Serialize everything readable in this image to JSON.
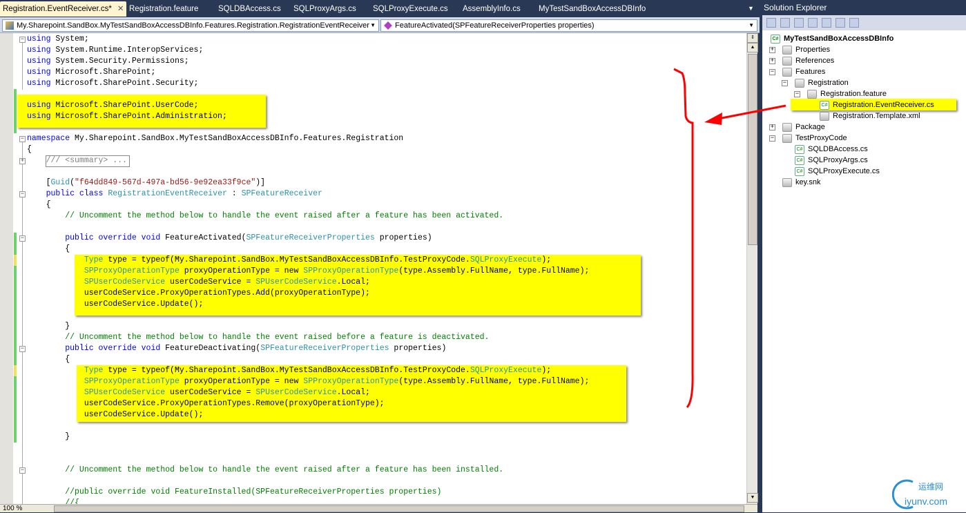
{
  "tabs": [
    {
      "label": "Registration.EventReceiver.cs*",
      "active": true
    },
    {
      "label": "Registration.feature"
    },
    {
      "label": "SQLDBAccess.cs"
    },
    {
      "label": "SQLProxyArgs.cs"
    },
    {
      "label": "SQLProxyExecute.cs"
    },
    {
      "label": "AssemblyInfo.cs"
    },
    {
      "label": "MyTestSandBoxAccessDBInfo"
    }
  ],
  "nav": {
    "type_selector": "My.Sharepoint.SandBox.MyTestSandBoxAccessDBInfo.Features.Registration.RegistrationEventReceiver",
    "member_selector": "FeatureActivated(SPFeatureReceiverProperties properties)"
  },
  "code": [
    [
      [
        "k",
        "using"
      ],
      [
        "p",
        " System;"
      ]
    ],
    [
      [
        "k",
        "using"
      ],
      [
        "p",
        " System.Runtime.InteropServices;"
      ]
    ],
    [
      [
        "k",
        "using"
      ],
      [
        "p",
        " System.Security.Permissions;"
      ]
    ],
    [
      [
        "k",
        "using"
      ],
      [
        "p",
        " Microsoft.SharePoint;"
      ]
    ],
    [
      [
        "k",
        "using"
      ],
      [
        "p",
        " Microsoft.SharePoint.Security;"
      ]
    ],
    [],
    [
      [
        "k",
        "using"
      ],
      [
        "p",
        " Microsoft.SharePoint.UserCode;"
      ]
    ],
    [
      [
        "k",
        "using"
      ],
      [
        "p",
        " Microsoft.SharePoint.Administration;"
      ]
    ],
    [],
    [
      [
        "k",
        "namespace"
      ],
      [
        "p",
        " My.Sharepoint.SandBox.MyTestSandBoxAccessDBInfo.Features.Registration"
      ]
    ],
    [
      [
        "p",
        "{"
      ]
    ],
    [
      [
        "p",
        "    "
      ],
      [
        "g",
        "/// <summary> ..."
      ]
    ],
    [],
    [
      [
        "p",
        "    ["
      ],
      [
        "t",
        "Guid"
      ],
      [
        "p",
        "("
      ],
      [
        "s",
        "\"f64dd849-567d-497a-bd56-9e92ea33f9ce\""
      ],
      [
        "p",
        ")]"
      ]
    ],
    [
      [
        "p",
        "    "
      ],
      [
        "k",
        "public class"
      ],
      [
        "p",
        " "
      ],
      [
        "t",
        "RegistrationEventReceiver"
      ],
      [
        "p",
        " : "
      ],
      [
        "t",
        "SPFeatureReceiver"
      ]
    ],
    [
      [
        "p",
        "    {"
      ]
    ],
    [
      [
        "p",
        "        "
      ],
      [
        "c",
        "// Uncomment the method below to handle the event raised after a feature has been activated."
      ]
    ],
    [],
    [
      [
        "p",
        "        "
      ],
      [
        "k",
        "public override void"
      ],
      [
        "p",
        " FeatureActivated("
      ],
      [
        "t",
        "SPFeatureReceiverProperties"
      ],
      [
        "p",
        " properties)"
      ]
    ],
    [
      [
        "p",
        "        {"
      ]
    ],
    [
      [
        "p",
        "            "
      ],
      [
        "t",
        "Type"
      ],
      [
        "p",
        " type = typeof(My.Sharepoint.SandBox.MyTestSandBoxAccessDBInfo.TestProxyCode."
      ],
      [
        "t",
        "SQLProxyExecute"
      ],
      [
        "p",
        ");"
      ]
    ],
    [
      [
        "p",
        "            "
      ],
      [
        "t",
        "SPProxyOperationType"
      ],
      [
        "p",
        " proxyOperationType = new "
      ],
      [
        "t",
        "SPProxyOperationType"
      ],
      [
        "p",
        "(type.Assembly.FullName, type.FullName);"
      ]
    ],
    [
      [
        "p",
        "            "
      ],
      [
        "t",
        "SPUserCodeService"
      ],
      [
        "p",
        " userCodeService = "
      ],
      [
        "t",
        "SPUserCodeService"
      ],
      [
        "p",
        ".Local;"
      ]
    ],
    [
      [
        "p",
        "            userCodeService.ProxyOperationTypes.Add(proxyOperationType);"
      ]
    ],
    [
      [
        "p",
        "            userCodeService.Update();"
      ]
    ],
    [],
    [
      [
        "p",
        "        }"
      ]
    ],
    [
      [
        "p",
        "        "
      ],
      [
        "c",
        "// Uncomment the method below to handle the event raised before a feature is deactivated."
      ]
    ],
    [
      [
        "p",
        "        "
      ],
      [
        "k",
        "public override void"
      ],
      [
        "p",
        " FeatureDeactivating("
      ],
      [
        "t",
        "SPFeatureReceiverProperties"
      ],
      [
        "p",
        " properties)"
      ]
    ],
    [
      [
        "p",
        "        {"
      ]
    ],
    [
      [
        "p",
        "            "
      ],
      [
        "t",
        "Type"
      ],
      [
        "p",
        " type = typeof(My.Sharepoint.SandBox.MyTestSandBoxAccessDBInfo.TestProxyCode."
      ],
      [
        "t",
        "SQLProxyExecute"
      ],
      [
        "p",
        ");"
      ]
    ],
    [
      [
        "p",
        "            "
      ],
      [
        "t",
        "SPProxyOperationType"
      ],
      [
        "p",
        " proxyOperationType = new "
      ],
      [
        "t",
        "SPProxyOperationType"
      ],
      [
        "p",
        "(type.Assembly.FullName, type.FullName);"
      ]
    ],
    [
      [
        "p",
        "            "
      ],
      [
        "t",
        "SPUserCodeService"
      ],
      [
        "p",
        " userCodeService = "
      ],
      [
        "t",
        "SPUserCodeService"
      ],
      [
        "p",
        ".Local;"
      ]
    ],
    [
      [
        "p",
        "            userCodeService.ProxyOperationTypes.Remove(proxyOperationType);"
      ]
    ],
    [
      [
        "p",
        "            userCodeService.Update();"
      ]
    ],
    [],
    [
      [
        "p",
        "        }"
      ]
    ],
    [],
    [],
    [
      [
        "p",
        "        "
      ],
      [
        "c",
        "// Uncomment the method below to handle the event raised after a feature has been installed."
      ]
    ],
    [],
    [
      [
        "p",
        "        "
      ],
      [
        "c",
        "//public override void FeatureInstalled(SPFeatureReceiverProperties properties)"
      ]
    ],
    [
      [
        "p",
        "        "
      ],
      [
        "c",
        "//{"
      ]
    ]
  ],
  "status": {
    "zoom": "100 %"
  },
  "solution_explorer": {
    "title": "Solution Explorer",
    "project": "MyTestSandBoxAccessDBInfo",
    "items": [
      {
        "label": "Properties",
        "level": 1,
        "toggle": "+"
      },
      {
        "label": "References",
        "level": 1,
        "toggle": "+"
      },
      {
        "label": "Features",
        "level": 1,
        "toggle": "-"
      },
      {
        "label": "Registration",
        "level": 2,
        "toggle": "-"
      },
      {
        "label": "Registration.feature",
        "level": 3,
        "toggle": "-"
      },
      {
        "label": "Registration.EventReceiver.cs",
        "level": 4,
        "selected": true
      },
      {
        "label": "Registration.Template.xml",
        "level": 4
      },
      {
        "label": "Package",
        "level": 1,
        "toggle": "+"
      },
      {
        "label": "TestProxyCode",
        "level": 1,
        "toggle": "-"
      },
      {
        "label": "SQLDBAccess.cs",
        "level": 2
      },
      {
        "label": "SQLProxyArgs.cs",
        "level": 2
      },
      {
        "label": "SQLProxyExecute.cs",
        "level": 2
      },
      {
        "label": "key.snk",
        "level": 1
      }
    ]
  },
  "watermark": {
    "line1": "运维网",
    "line2": "iyunv.com"
  },
  "colors": {
    "highlight": "#ffff00",
    "annotation": "#ff0000",
    "keyword": "#0000ff",
    "type": "#2b91af",
    "string": "#a31515",
    "comment": "#008000"
  }
}
